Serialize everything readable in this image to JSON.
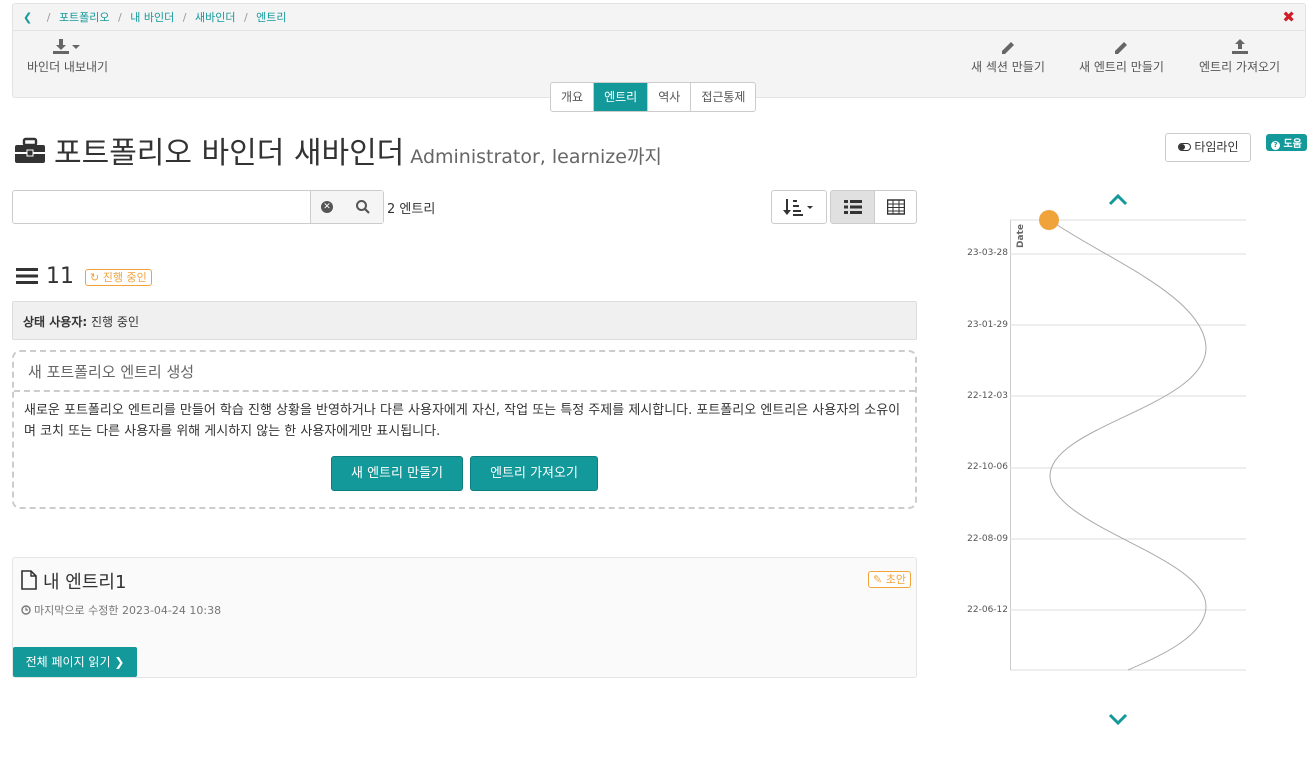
{
  "breadcrumb": [
    "포트폴리오",
    "내 바인더",
    "새바인더",
    "엔트리"
  ],
  "toolbar": {
    "export_label": "바인더 내보내기",
    "new_section_label": "새 섹션 만들기",
    "new_entry_label": "새 엔트리 만들기",
    "import_entry_label": "엔트리 가져오기"
  },
  "tabs": [
    {
      "label": "개요",
      "active": false
    },
    {
      "label": "엔트리",
      "active": true
    },
    {
      "label": "역사",
      "active": false
    },
    {
      "label": "접근통제",
      "active": false
    }
  ],
  "title": {
    "main": "포트폴리오 바인더 새바인더",
    "sub": "Administrator, learnize까지"
  },
  "timeline_button": "타임라인",
  "help_label": "도움",
  "search": {
    "value": "",
    "placeholder": ""
  },
  "entry_count": "2 엔트리",
  "section": {
    "number": "11",
    "status_badge": "진행 중인",
    "status_label": "상태 사용자:",
    "status_value": "진행 중인"
  },
  "create_box": {
    "title": "새 포트폴리오 엔트리 생성",
    "description": "새로운 포트폴리오 엔트리를 만들어 학습 진행 상황을 반영하거나 다른 사용자에게 자신, 작업 또는 특정 주제를 제시합니다. 포트폴리오 엔트리은 사용자의 소유이며 코치 또는 다른 사용자를 위해 게시하지 않는 한 사용자에게만 표시됩니다.",
    "new_button": "새 엔트리 만들기",
    "import_button": "엔트리 가져오기"
  },
  "entry": {
    "title": "내 엔트리1",
    "draft_badge": "초안",
    "modified": "마지막으로 수정한 2023-04-24 10:38",
    "read_more": "전체 페이지 읽기"
  },
  "timeline": {
    "axis_label": "Date",
    "dates": [
      "23-03-28",
      "23-01-29",
      "22-12-03",
      "22-10-06",
      "22-08-09",
      "22-06-12"
    ]
  },
  "colors": {
    "accent": "#14999a",
    "draft": "#f0a33b",
    "danger": "#d01d27"
  }
}
